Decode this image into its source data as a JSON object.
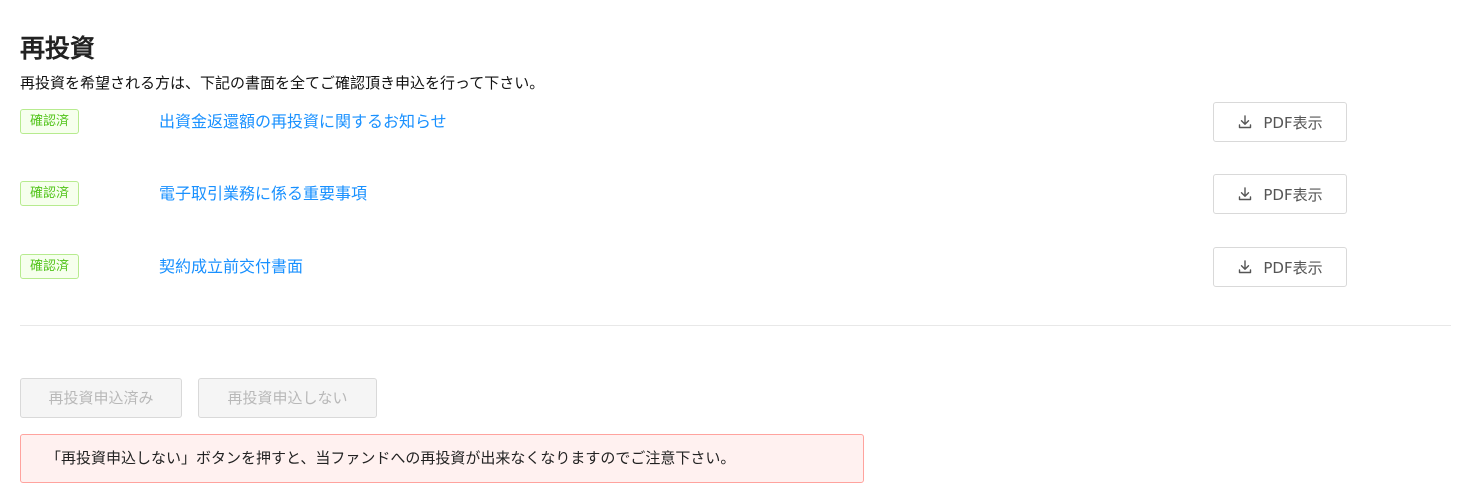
{
  "page": {
    "title": "再投資",
    "description": "再投資を希望される方は、下記の書面を全てご確認頂き申込を行って下さい。"
  },
  "documents": [
    {
      "status": "確認済",
      "title": "出資金返還額の再投資に関するお知らせ",
      "button_label": "PDF表示"
    },
    {
      "status": "確認済",
      "title": "電子取引業務に係る重要事項",
      "button_label": "PDF表示"
    },
    {
      "status": "確認済",
      "title": "契約成立前交付書面",
      "button_label": "PDF表示"
    }
  ],
  "actions": {
    "applied_label": "再投資申込済み",
    "decline_label": "再投資申込しない"
  },
  "notice": {
    "text": "「再投資申込しない」ボタンを押すと、当ファンドへの再投資が出来なくなりますのでご注意下さい。"
  },
  "colors": {
    "link": "#1890ff",
    "badge_text": "#52c41a",
    "badge_border": "#b7eb8f",
    "badge_bg": "#f6ffed",
    "alert_border": "#ffa39e",
    "alert_bg": "#fff1f0"
  },
  "icons": {
    "pdf_button": "download-icon"
  }
}
